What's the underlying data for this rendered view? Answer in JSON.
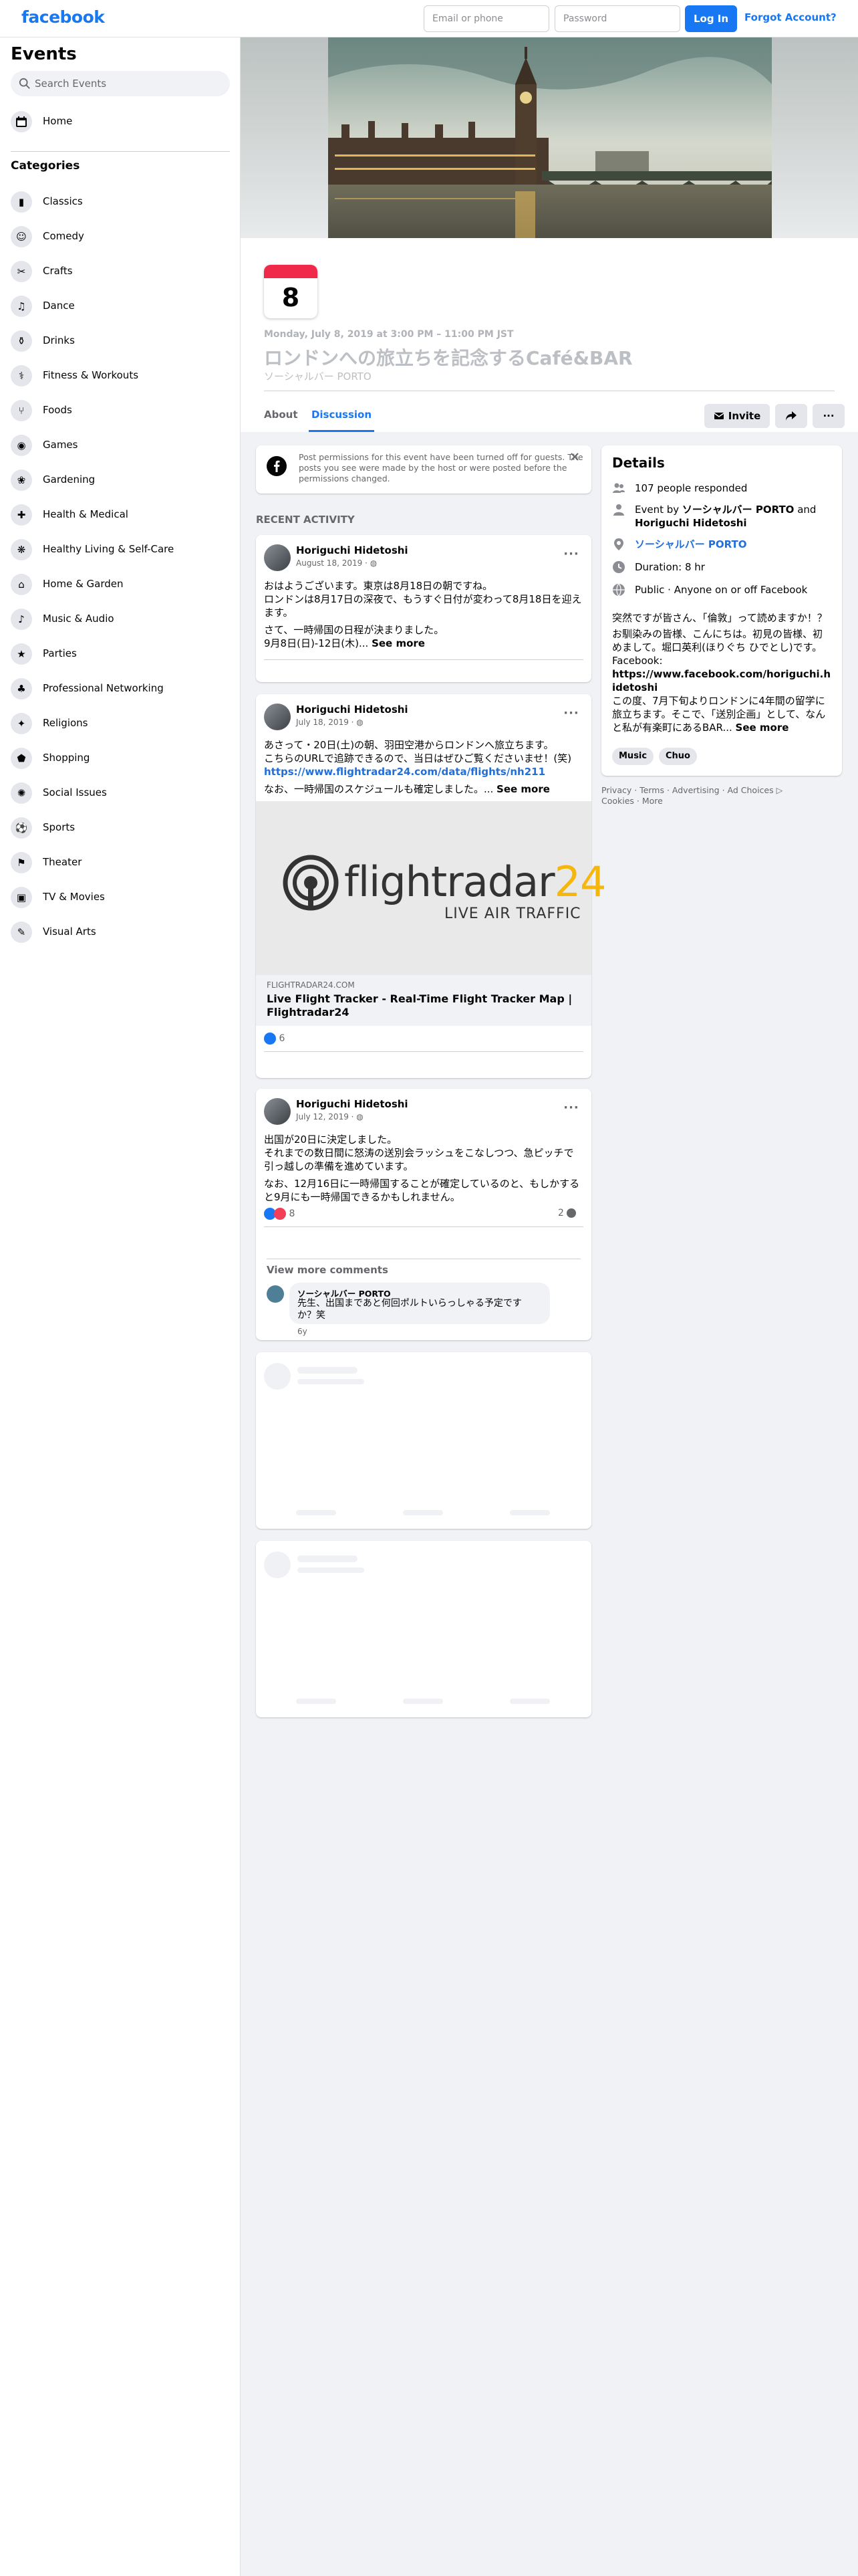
{
  "topbar": {
    "logo": "facebook",
    "email_placeholder": "Email or phone",
    "password_placeholder": "Password",
    "login_label": "Log In",
    "forgot_label": "Forgot Account?"
  },
  "sidebar": {
    "title": "Events",
    "search_placeholder": "Search Events",
    "home_label": "Home",
    "categories_title": "Categories",
    "categories": [
      {
        "label": "Classics",
        "icon": "classics-icon"
      },
      {
        "label": "Comedy",
        "icon": "comedy-icon"
      },
      {
        "label": "Crafts",
        "icon": "crafts-icon"
      },
      {
        "label": "Dance",
        "icon": "dance-icon"
      },
      {
        "label": "Drinks",
        "icon": "drinks-icon"
      },
      {
        "label": "Fitness & Workouts",
        "icon": "fitness-icon"
      },
      {
        "label": "Foods",
        "icon": "foods-icon"
      },
      {
        "label": "Games",
        "icon": "games-icon"
      },
      {
        "label": "Gardening",
        "icon": "gardening-icon"
      },
      {
        "label": "Health & Medical",
        "icon": "health-icon"
      },
      {
        "label": "Healthy Living & Self-Care",
        "icon": "self-care-icon"
      },
      {
        "label": "Home & Garden",
        "icon": "home-garden-icon"
      },
      {
        "label": "Music & Audio",
        "icon": "music-icon"
      },
      {
        "label": "Parties",
        "icon": "parties-icon"
      },
      {
        "label": "Professional Networking",
        "icon": "networking-icon"
      },
      {
        "label": "Religions",
        "icon": "religions-icon"
      },
      {
        "label": "Shopping",
        "icon": "shopping-icon"
      },
      {
        "label": "Social Issues",
        "icon": "social-issues-icon"
      },
      {
        "label": "Sports",
        "icon": "sports-icon"
      },
      {
        "label": "Theater",
        "icon": "theater-icon"
      },
      {
        "label": "TV & Movies",
        "icon": "tv-movies-icon"
      },
      {
        "label": "Visual Arts",
        "icon": "visual-arts-icon"
      }
    ]
  },
  "event": {
    "day": "8",
    "date_line": "Monday, July 8, 2019 at 3:00 PM – 11:00 PM JST",
    "title": "ロンドンへの旅立ちを記念するCafé&BAR",
    "host": "ソーシャルバー PORTO",
    "tabs": {
      "about": "About",
      "discussion": "Discussion"
    },
    "invite_label": "Invite",
    "more_label": "···"
  },
  "notice": {
    "text": "Post permissions for this event have been turned off for guests. The posts you see were made by the host or were posted before the permissions changed."
  },
  "recent_activity_label": "RECENT ACTIVITY",
  "posts": [
    {
      "author": "Horiguchi Hidetoshi",
      "date": "August 18, 2019 · ",
      "lines": [
        "おはようございます。東京は8月18日の朝ですね。",
        "ロンドンは8月17日の深夜で、もうすぐ日付が変わって8月18日を迎え",
        "ます。",
        "さて、一時帰国の日程が決まりました。"
      ],
      "last_line": "9月8日(日)-12日(木)... ",
      "see_more": "See more"
    },
    {
      "author": "Horiguchi Hidetoshi",
      "date": "July 18, 2019 · ",
      "lines": [
        "あさって・20日(土)の朝、羽田空港からロンドンへ旅立ちます。",
        "こちらのURLで追跡できるので、当日はぜひご覧くださいませ！(笑)"
      ],
      "url": "https://www.flightradar24.com/data/flights/nh211",
      "last_line": "なお、一時帰国のスケジュールも確定しました。... ",
      "see_more": "See more",
      "link_preview": {
        "brand": "flightradar",
        "brand_num": "24",
        "tagline": "LIVE AIR TRAFFIC",
        "domain": "FLIGHTRADAR24.COM",
        "title": "Live Flight Tracker - Real-Time Flight Tracker Map | Flightradar24"
      },
      "reactions": "6"
    },
    {
      "author": "Horiguchi Hidetoshi",
      "date": "July 12, 2019 · ",
      "lines": [
        "出国が20日に決定しました。",
        "それまでの数日間に怒涛の送別会ラッシュをこなしつつ、急ピッチで",
        "引っ越しの準備を進めています。",
        "なお、12月16日に一時帰国することが確定しているのと、もしかする",
        "と9月にも一時帰国できるかもしれません。"
      ],
      "reactions": "8",
      "comments_count": "2",
      "view_more": "View more comments",
      "comment": {
        "author": "ソーシャルバー PORTO",
        "lines": [
          "先生、出国まであと何回ポルトいらっしゃる予定です",
          "か？笑"
        ],
        "age": "6y"
      }
    }
  ],
  "details": {
    "title": "Details",
    "responded": "107 people responded",
    "event_by_prefix": "Event by ",
    "event_by_host": "ソーシャルバー PORTO",
    "event_by_and": " and",
    "event_by_person": "Horiguchi Hidetoshi",
    "location": "ソーシャルバー PORTO",
    "duration": "Duration: 8 hr",
    "privacy": "Public · Anyone on or off Facebook",
    "desc_lines": [
      "突然ですが皆さん、「倫敦」って読めますか！？",
      "お馴染みの皆様、こんにちは。初見の皆様、初",
      "めまして。堀口英利(ほりぐち ひでとし)です。",
      "Facebook:"
    ],
    "fb_url_1": "https://www.facebook.com/horiguchi.h",
    "fb_url_2": "idetoshi",
    "desc_lines_2": [
      "この度、7月下旬よりロンドンに4年間の留学に",
      "旅立ちます。そこで、「送別企画」として、なん"
    ],
    "desc_last": "と私が有楽町にあるBAR... ",
    "see_more": "See more",
    "tags": [
      "Music",
      "Chuo"
    ]
  },
  "footer": {
    "line1": "Privacy · Terms · Advertising · Ad Choices ",
    "line2": "Cookies · More"
  }
}
